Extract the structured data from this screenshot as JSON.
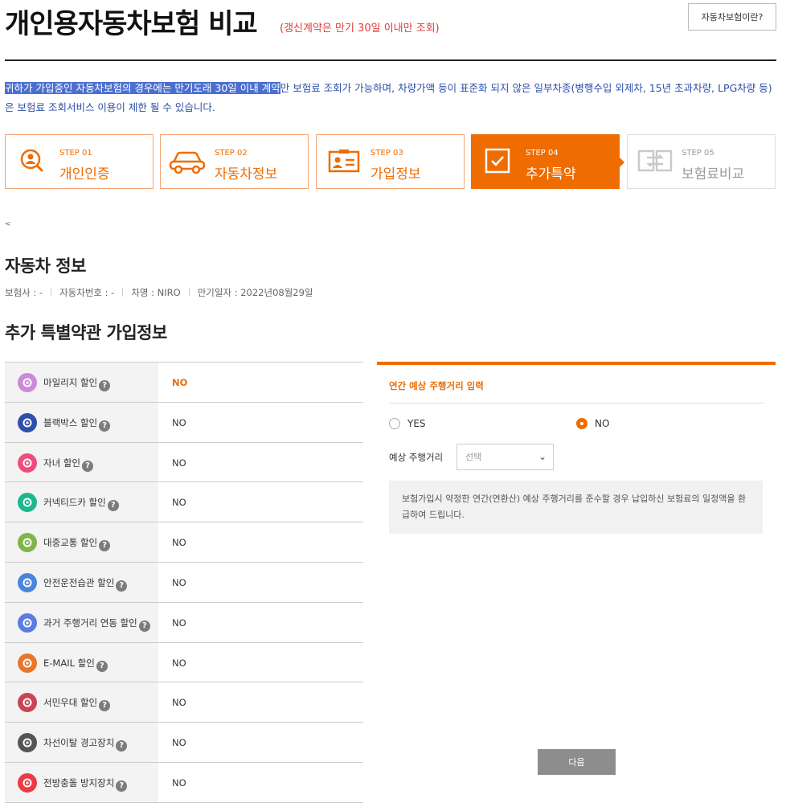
{
  "header": {
    "title": "개인용자동차보험 비교",
    "subtitle": "(갱신계약은 만기 30일 이내만 조회)",
    "help_button": "자동차보험이란?"
  },
  "notice": {
    "highlighted": "귀하가 가입중인 자동차보험의 경우에는 만기도래 30일 이내 계약",
    "rest": "만 보험료 조회가 가능하며, 차량가액 등이 표준화 되지 않은 일부차종(병행수입 외제차, 15년 초과차량, LPG차량 등)은 보험료 조회서비스 이용이 제한 될 수 있습니다."
  },
  "steps": [
    {
      "num": "STEP 01",
      "name": "개인인증",
      "icon": "person-search-icon",
      "state": "done"
    },
    {
      "num": "STEP 02",
      "name": "자동차정보",
      "icon": "car-icon",
      "state": "done"
    },
    {
      "num": "STEP 03",
      "name": "가입정보",
      "icon": "id-card-icon",
      "state": "done"
    },
    {
      "num": "STEP 04",
      "name": "추가특약",
      "icon": "checkbox-icon",
      "state": "active"
    },
    {
      "num": "STEP 05",
      "name": "보험료비교",
      "icon": "compare-icon",
      "state": "disabled"
    }
  ],
  "small_mark": "<",
  "car_section": {
    "title": "자동차 정보",
    "insurer": "보험사 : -",
    "car_number": "자동차번호 : -",
    "car_name": "차명 : NIRO",
    "expiry": "만기일자 : 2022년08월29일"
  },
  "discount_section": {
    "title": "추가 특별약관 가입정보",
    "help_glyph": "?",
    "rows": [
      {
        "label": "마일리지 할인",
        "value": "NO",
        "icon": "mileage-icon",
        "color": "#c98ad8",
        "selected": true
      },
      {
        "label": "블랙박스 할인",
        "value": "NO",
        "icon": "blackbox-icon",
        "color": "#2f4fa8",
        "selected": false
      },
      {
        "label": "자녀 할인",
        "value": "NO",
        "icon": "child-icon",
        "color": "#ec4f7d",
        "selected": false
      },
      {
        "label": "커넥티드카 할인",
        "value": "NO",
        "icon": "connected-car-icon",
        "color": "#1db68f",
        "selected": false
      },
      {
        "label": "대중교통 할인",
        "value": "NO",
        "icon": "bus-icon",
        "color": "#7fb54b",
        "selected": false
      },
      {
        "label": "안전운전습관 할인",
        "value": "NO",
        "icon": "safe-driving-icon",
        "color": "#4a86d8",
        "selected": false
      },
      {
        "label": "과거 주행거리 연동 할인",
        "value": "NO",
        "icon": "past-mileage-icon",
        "color": "#5b7de0",
        "selected": false
      },
      {
        "label": "E-MAIL 할인",
        "value": "NO",
        "icon": "email-icon",
        "color": "#e8762c",
        "selected": false
      },
      {
        "label": "서민우대 할인",
        "value": "NO",
        "icon": "store-icon",
        "color": "#c94455",
        "selected": false
      },
      {
        "label": "차선이탈 경고장치",
        "value": "NO",
        "icon": "lane-warning-icon",
        "color": "#555555",
        "selected": false
      },
      {
        "label": "전방충돌 방지장치",
        "value": "NO",
        "icon": "collision-icon",
        "color": "#ea3b46",
        "selected": false
      }
    ]
  },
  "panel": {
    "title": "연간 예상 주행거리 입력",
    "yes_label": "YES",
    "no_label": "NO",
    "selected": "NO",
    "distance_label": "예상 주행거리",
    "distance_value": "선택",
    "info": "보험가입시 약정한 연간(연환산) 예상 주행거리를 준수할 경우 납입하신 보험료의 일정액을 환급하여 드립니다.",
    "next_button": "다음"
  },
  "colors": {
    "accent": "#ef6c00",
    "notice": "#2a4ea8",
    "alert": "#e03a3a"
  }
}
